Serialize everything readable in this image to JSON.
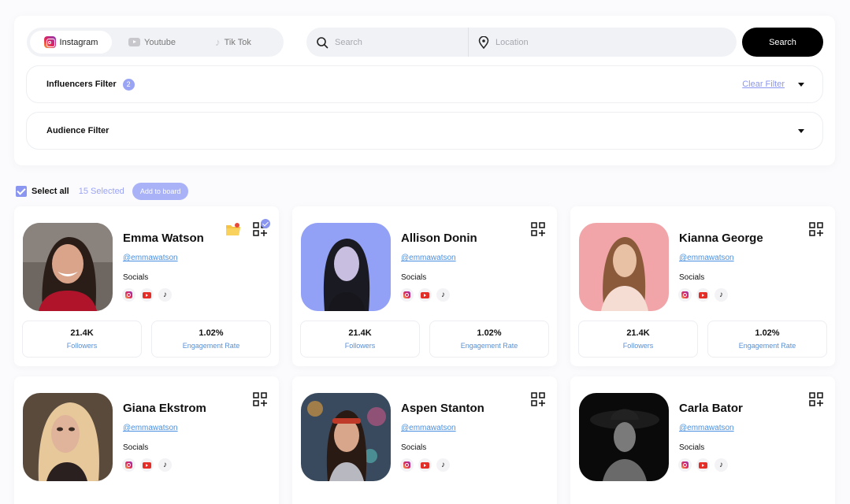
{
  "platforms": {
    "tabs": [
      {
        "label": "Instagram",
        "icon": "instagram-icon",
        "active": true
      },
      {
        "label": "Youtube",
        "icon": "youtube-icon",
        "active": false
      },
      {
        "label": "Tik Tok",
        "icon": "tiktok-icon",
        "active": false
      }
    ]
  },
  "search": {
    "placeholder": "Search",
    "location_placeholder": "Location",
    "button_label": "Search"
  },
  "filters": {
    "influencers": {
      "label": "Influencers Filter",
      "count": "2",
      "clear_label": "Clear Filter"
    },
    "audience": {
      "label": "Audience Filter"
    }
  },
  "selection": {
    "select_all_label": "Select all",
    "selected_count": "15 Selected",
    "add_to_board_label": "Add to board"
  },
  "colors": {
    "accent": "#8a96f0",
    "link": "#4a8fe0",
    "primary_button": "#000000",
    "youtube_red": "#e52d27"
  },
  "cards": [
    {
      "name": "Emma Watson",
      "handle": "@emmawatson",
      "socials_label": "Socials",
      "followers": "21.4K",
      "followers_label": "Followers",
      "engagement": "1.02%",
      "engagement_label": "Engagement Rate",
      "added_to_board": true
    },
    {
      "name": "Allison Donin",
      "handle": "@emmawatson",
      "socials_label": "Socials",
      "followers": "21.4K",
      "followers_label": "Followers",
      "engagement": "1.02%",
      "engagement_label": "Engagement Rate",
      "added_to_board": false
    },
    {
      "name": "Kianna George",
      "handle": "@emmawatson",
      "socials_label": "Socials",
      "followers": "21.4K",
      "followers_label": "Followers",
      "engagement": "1.02%",
      "engagement_label": "Engagement Rate",
      "added_to_board": false
    },
    {
      "name": "Giana Ekstrom",
      "handle": "@emmawatson",
      "socials_label": "Socials",
      "added_to_board": false
    },
    {
      "name": "Aspen Stanton",
      "handle": "@emmawatson",
      "socials_label": "Socials",
      "added_to_board": false
    },
    {
      "name": "Carla Bator",
      "handle": "@emmawatson",
      "socials_label": "Socials",
      "added_to_board": false
    }
  ]
}
